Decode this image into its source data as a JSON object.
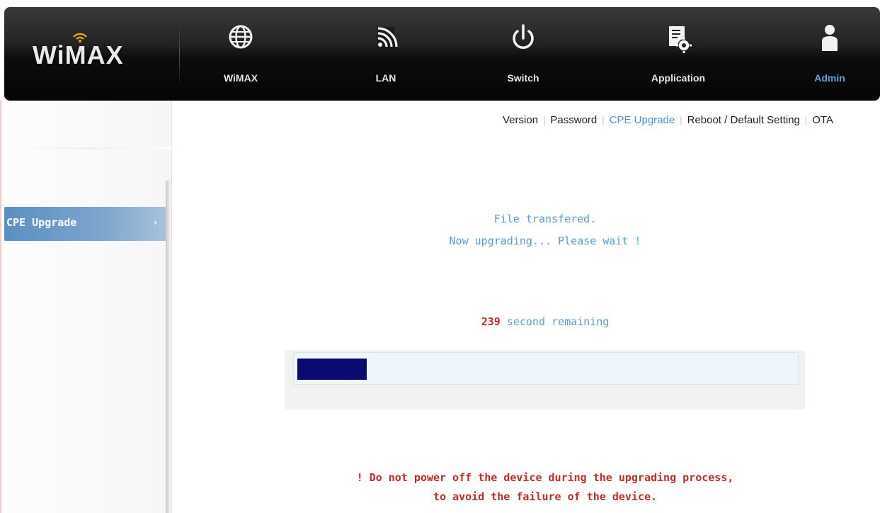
{
  "header": {
    "logo_text": "WiMAX",
    "nav": [
      {
        "label": "WiMAX",
        "icon": "globe-icon",
        "active": false
      },
      {
        "label": "LAN",
        "icon": "signal-icon",
        "active": false
      },
      {
        "label": "Switch",
        "icon": "power-icon",
        "active": false
      },
      {
        "label": "Application",
        "icon": "app-settings-icon",
        "active": false
      },
      {
        "label": "Admin",
        "icon": "user-icon",
        "active": true
      }
    ]
  },
  "subnav": {
    "items": [
      {
        "label": "Version",
        "active": false
      },
      {
        "label": "Password",
        "active": false
      },
      {
        "label": "CPE Upgrade",
        "active": true
      },
      {
        "label": "Reboot / Default Setting",
        "active": false
      },
      {
        "label": "OTA",
        "active": false
      }
    ]
  },
  "sidebar": {
    "items": [
      {
        "label": "CPE Upgrade",
        "arrow": "›"
      }
    ]
  },
  "main": {
    "status_line1": "File transfered.",
    "status_line2": "Now upgrading... Please wait !",
    "remaining_seconds": "239",
    "remaining_text": "second remaining",
    "progress_fraction": 0.14,
    "warning_line1": "! Do not power off the device during the upgrading process,",
    "warning_line2": "to avoid the failure of the device."
  },
  "colors": {
    "accent": "#4a94cf",
    "warning": "#c62a2a",
    "progress_fill": "#0a0a72",
    "header_bg": "#111111"
  }
}
